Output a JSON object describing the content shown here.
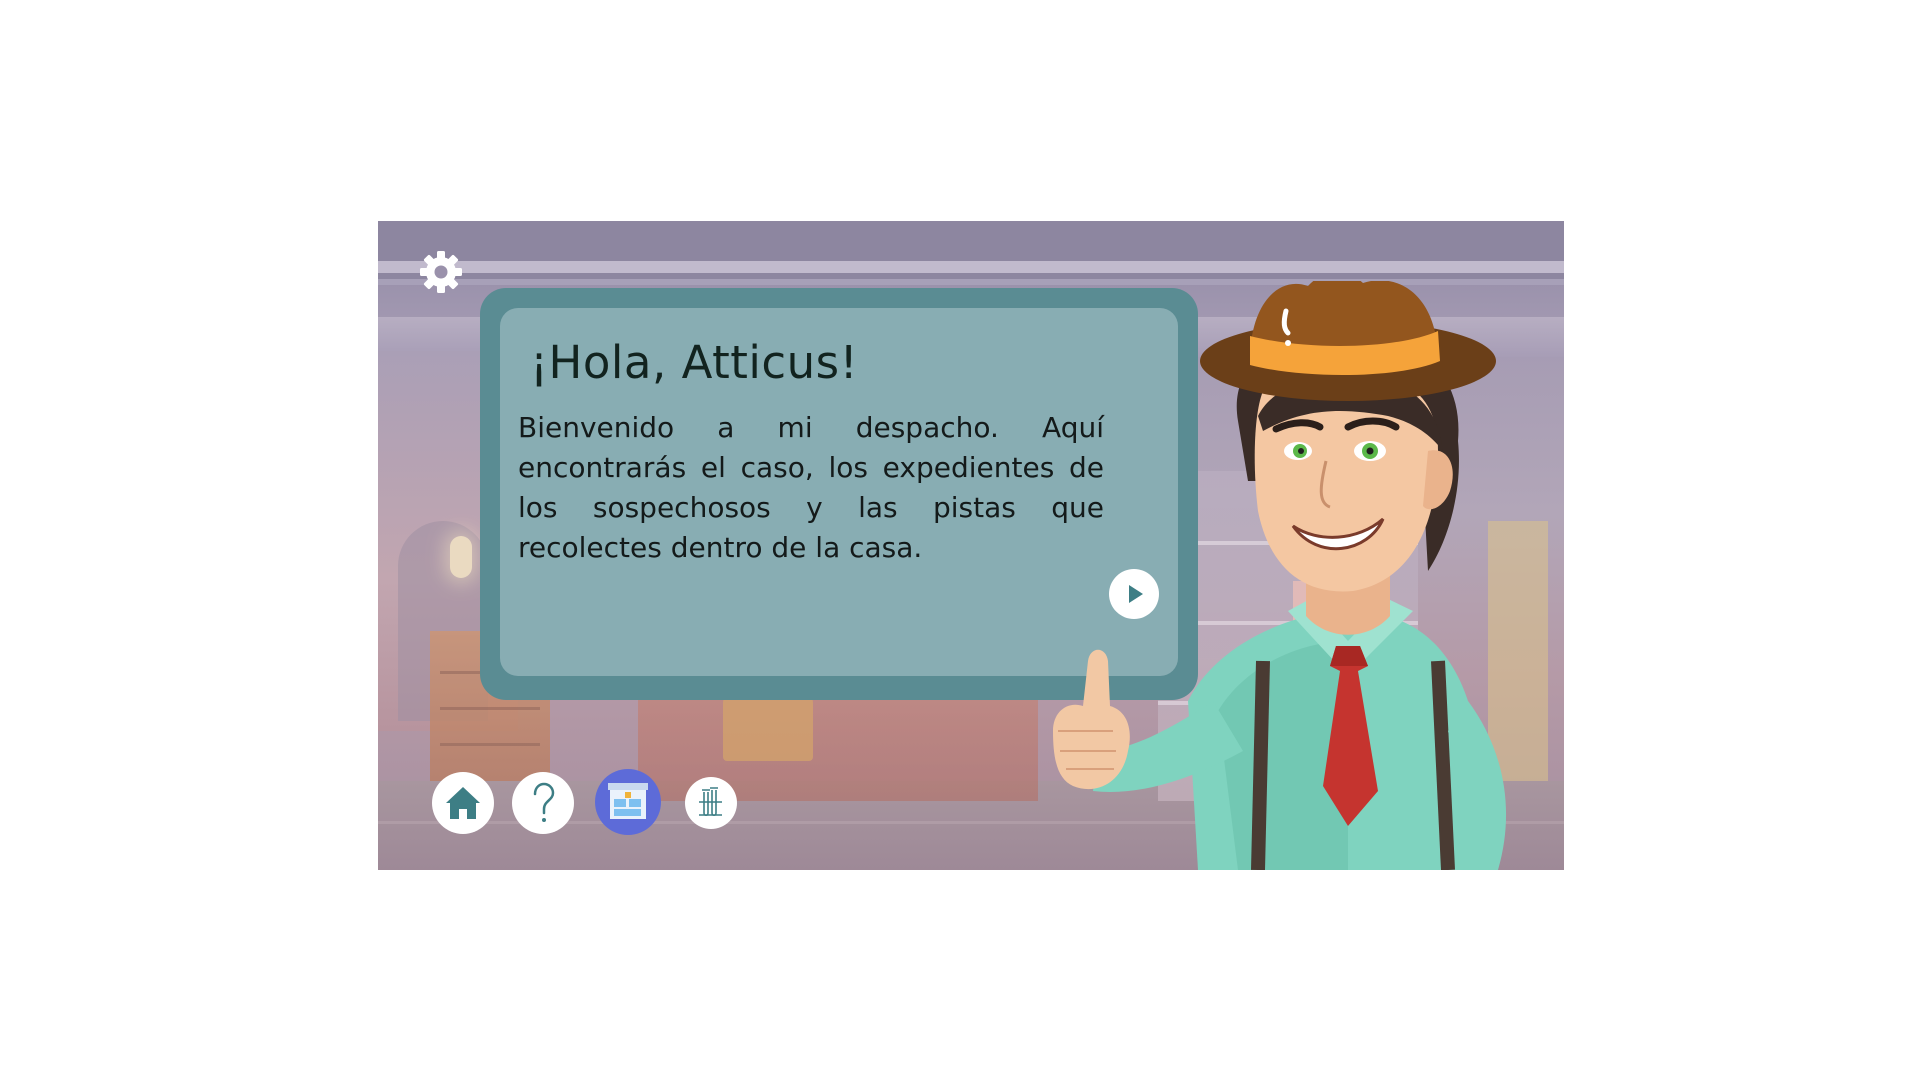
{
  "dialog": {
    "title": "¡Hola, Atticus!",
    "body": "Bienvenido a mi despacho. Aquí encontrarás el caso, los expedientes de los sospechosos y las pistas que recolectes dentro de la casa."
  },
  "icons": {
    "settings": "gear-icon",
    "next": "play-icon",
    "home": "home-icon",
    "help": "question-mark-icon",
    "cabinet": "cabinet-icon",
    "lab": "test-tubes-icon"
  },
  "colors": {
    "dialog_border": "#5a8c93",
    "dialog_fill": "#88adb3",
    "icon_teal": "#3d7e85",
    "active_button": "#5d6bd8"
  }
}
